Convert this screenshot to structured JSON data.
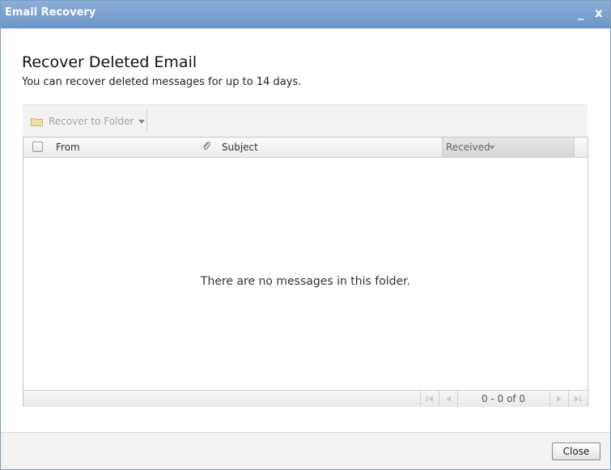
{
  "window": {
    "title": "Email Recovery",
    "minimize_label": "_",
    "close_label": "x"
  },
  "header": {
    "title": "Recover Deleted Email",
    "subtitle": "You can recover deleted messages for up to 14 days."
  },
  "toolbar": {
    "recover_label": "Recover to Folder",
    "recover_icon": "folder-icon"
  },
  "grid": {
    "columns": {
      "from": "From",
      "attachment_icon": "paperclip-icon",
      "subject": "Subject",
      "received": "Received"
    },
    "sorted_by": "received",
    "empty_message": "There are no messages in this folder."
  },
  "pager": {
    "info": "0 - 0 of 0"
  },
  "footer": {
    "close_label": "Close"
  },
  "colors": {
    "titlebar": "#7aa0d0",
    "title_text": "#ffffff",
    "disabled_text": "#a5a5a5"
  }
}
